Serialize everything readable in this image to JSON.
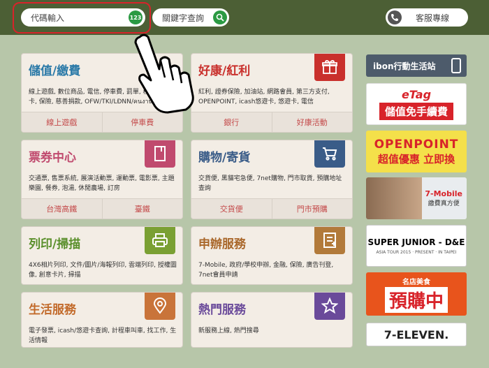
{
  "header": {
    "code_placeholder": "代碼輸入",
    "code_badge": "123",
    "keyword_placeholder": "關鍵字查詢",
    "service_label": "客服專線"
  },
  "cards": [
    {
      "title": "儲值/繳費",
      "desc": "線上遊戲, 數位商品, 電信, 停車費, 罰單, 稅款 信用卡, 保險, 慈善捐款, OFW/TKI/LĐNN/คนงาน",
      "links": [
        "線上遊戲",
        "停車費"
      ]
    },
    {
      "title": "好康/紅利",
      "desc": "紅利, 證券保險, 加油站, 網路會員, 第三方支付, OPENPOINT, icash悠遊卡, 悠遊卡, 電信",
      "links": [
        "銀行",
        "好康活動"
      ]
    },
    {
      "title": "票券中心",
      "desc": "交通票, 售票系統, 展演活動票, 運動票, 電影票, 主題樂園, 餐券, 泡湯, 休閒農場, 訂房",
      "links": [
        "台灣高鐵",
        "臺鐵"
      ]
    },
    {
      "title": "購物/寄貨",
      "desc": "交貨便, 黑貓宅急便, 7net購物, 門市取貨, 預購地址查詢",
      "links": [
        "交貨便",
        "門市預購"
      ]
    },
    {
      "title": "列印/掃描",
      "desc": "4X6相片列印, 文件/圖片/海報列印, 雲端列印, 授權圖像, 創意卡片, 掃描"
    },
    {
      "title": "申辦服務",
      "desc": "7-Mobile, 政府/學校申辦, 金融, 保險, 廣告刊登, 7net會員申請"
    },
    {
      "title": "生活服務",
      "desc": "電子發票, icash/悠遊卡查詢, 計程車叫車, 找工作, 生活情報"
    },
    {
      "title": "熱門服務",
      "desc": "新服務上線, 熱門搜尋"
    }
  ],
  "banners": {
    "ibon": "ibon行動生活站",
    "etag_top": "eTag",
    "etag_bottom": "儲值免手續費",
    "openpoint_top": "OPENPOINT",
    "openpoint_bottom": "超值優惠 立即換",
    "mobile_brand": "7-Mobile",
    "mobile_sub": "繳費真方便",
    "sj_title": "SUPER JUNIOR - D&E",
    "sj_sub": "ASIA TOUR 2015 · PRESENT · IN TAIPEI",
    "preorder_top": "名店美食",
    "preorder_main": "預購中",
    "seven": "7-ELEVEN."
  },
  "colors": {
    "green_bar": "#4c5f35",
    "accent_green": "#2b9a43",
    "card_red": "#c9302c"
  }
}
